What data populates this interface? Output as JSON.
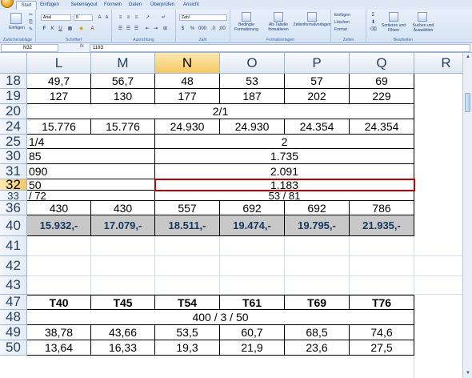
{
  "ribbon": {
    "tabs": [
      "Start",
      "Einfügen",
      "Seitenlayout",
      "Formeln",
      "Daten",
      "Überprüfen",
      "Ansicht"
    ],
    "font_name": "Arial",
    "font_size": "8",
    "number_format": "Zahl",
    "paste_label": "Einfügen",
    "groups": [
      "Zwischenablage",
      "Schriftart",
      "Ausrichtung",
      "Zahl",
      "Formatvorlagen",
      "Zellen",
      "Bearbeiten"
    ],
    "cond_format": "Bedingte Formatierung",
    "as_table": "Als Tabelle formatieren",
    "cell_styles": "Zellenformatvorlagen",
    "insert": "Einfügen",
    "delete": "Löschen",
    "format": "Format",
    "sort": "Sortieren und Filtern",
    "find": "Suchen und Auswählen"
  },
  "formula_bar": {
    "name_box": "N32",
    "fx": "fx",
    "value": "1183"
  },
  "columns": [
    "L",
    "M",
    "N",
    "O",
    "P",
    "Q",
    "R"
  ],
  "selected_col": "N",
  "rows": {
    "r18": {
      "hdr": "18",
      "L": "49,7",
      "M": "56,7",
      "N": "48",
      "O": "53",
      "P": "57",
      "Q": "69"
    },
    "r19": {
      "hdr": "19",
      "L": "127",
      "M": "130",
      "N": "177",
      "O": "187",
      "P": "202",
      "Q": "229"
    },
    "r20": {
      "hdr": "20",
      "merged": "2/1"
    },
    "r24": {
      "hdr": "24",
      "L": "15.776",
      "M": "15.776",
      "N": "24.930",
      "O": "24.930",
      "P": "24.354",
      "Q": "24.354"
    },
    "r25": {
      "hdr": "25",
      "left": "1/4",
      "right": "2"
    },
    "r30": {
      "hdr": "30",
      "left": "85",
      "right": "1.735"
    },
    "r31": {
      "hdr": "31",
      "left": "090",
      "right": "2.091"
    },
    "r32": {
      "hdr": "32",
      "left": "50",
      "right": "1.183"
    },
    "r33": {
      "hdr": "33",
      "left": "/ 72",
      "right": "53 / 81"
    },
    "r36": {
      "hdr": "36",
      "L": "430",
      "M": "430",
      "N": "557",
      "O": "692",
      "P": "692",
      "Q": "786"
    },
    "r40": {
      "hdr": "40",
      "L": "15.932,-",
      "M": "17.079,-",
      "N": "18.511,-",
      "O": "19.474,-",
      "P": "19.795,-",
      "Q": "21.935,-"
    },
    "r41": {
      "hdr": "41"
    },
    "r42": {
      "hdr": "42"
    },
    "r43": {
      "hdr": "43"
    },
    "r47": {
      "hdr": "47",
      "L": "T40",
      "M": "T45",
      "N": "T54",
      "O": "T61",
      "P": "T69",
      "Q": "T76"
    },
    "r48": {
      "hdr": "48",
      "merged": "400 / 3 / 50"
    },
    "r49": {
      "hdr": "49",
      "L": "38,78",
      "M": "43,66",
      "N": "53,5",
      "O": "60,7",
      "P": "68,5",
      "Q": "74,6"
    },
    "r50": {
      "hdr": "50",
      "L": "13,64",
      "M": "16,33",
      "N": "19,3",
      "O": "21,9",
      "P": "23,6",
      "Q": "27,5"
    }
  }
}
